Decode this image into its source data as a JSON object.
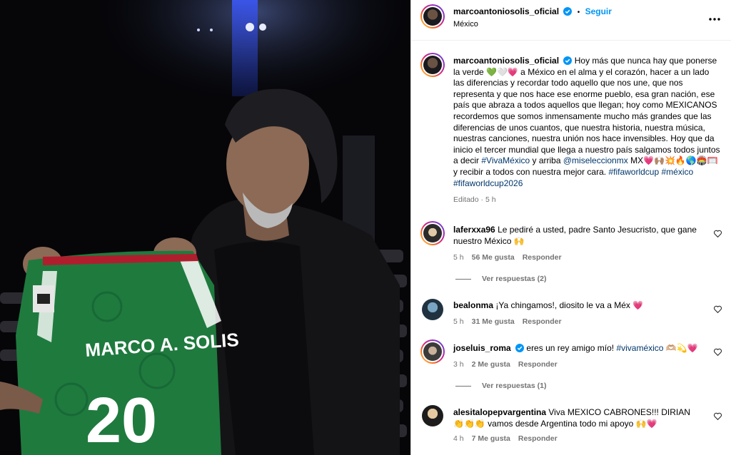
{
  "post": {
    "author": "marcoantoniosolis_oficial",
    "separator": "•",
    "follow_label": "Seguir",
    "location": "México",
    "more_label": "•••"
  },
  "caption": {
    "author": "marcoantoniosolis_oficial",
    "text_1": "Hoy más que nunca hay que ponerse la verde 💚🤍💗 a México en el alma y el corazón, hacer a un lado las diferencias y recordar todo aquello que nos une, que nos representa y que nos hace ese enorme pueblo, esa gran nación, ese país que abraza a todos aquellos que llegan; hoy como MEXICANOS recordemos que somos inmensamente mucho más grandes que las diferencias de unos cuantos, que nuestra historia, nuestra música, nuestras canciones, nuestra unión nos hace invensibles. Hoy que da inicio el tercer mundial que llega a nuestro país salgamos todos juntos a decir ",
    "tag_viva": "#VivaMéxico",
    "text_2": " y arriba ",
    "tag_seleccion": "@miseleccionmx",
    "text_3": " MX💗🙌🏽💥🔥🌎🏟️🥅 y recibir a todos con nuestra mejor cara. ",
    "hashtags": "#fifaworldcup #méxico #fifaworldcup2026",
    "edited": "Editado · 5 h"
  },
  "comments": [
    {
      "user": "laferxxa96",
      "text": "Le pediré a usted, padre Santo Jesucristo, que gane nuestro México 🙌",
      "time": "5 h",
      "likes": "56 Me gusta",
      "reply": "Responder",
      "view_replies": "Ver respuestas (2)"
    },
    {
      "user": "bealonma",
      "text": "¡Ya chingamos!, diosito le va a Méx 💗",
      "time": "5 h",
      "likes": "31 Me gusta",
      "reply": "Responder"
    },
    {
      "user": "joseluis_roma",
      "text_pre": "eres un rey amigo mío! ",
      "tag": "#vivaméxico",
      "text_post": " 🫶🏼💫💗",
      "time": "3 h",
      "likes": "2 Me gusta",
      "reply": "Responder",
      "view_replies": "Ver respuestas (1)"
    },
    {
      "user": "alesitalopepvargentina",
      "text": "Viva MEXICO CABRONES!!! DIRIAN 👏👏👏 vamos desde Argentina todo mi apoyo 🙌💗",
      "time": "4 h",
      "likes": "7 Me gusta",
      "reply": "Responder"
    }
  ],
  "jersey": {
    "name_print": "MARCO A. SOLIS",
    "number_print": "20"
  },
  "colors": {
    "accent_blue": "#0095f6",
    "hashtag": "#00376b",
    "verified": "#0095f6",
    "muted": "#737373",
    "jersey_green": "#1f7a3e"
  }
}
